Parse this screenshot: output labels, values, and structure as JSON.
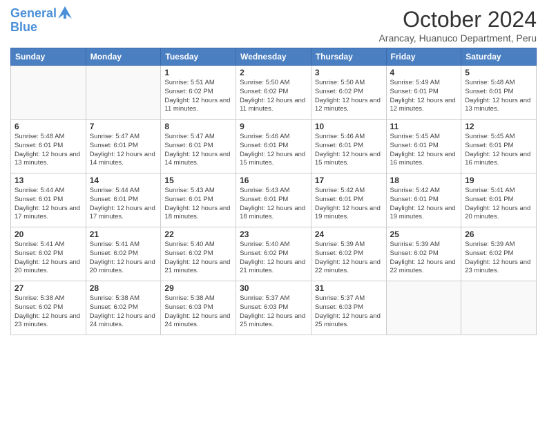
{
  "logo": {
    "line1": "General",
    "line2": "Blue"
  },
  "title": "October 2024",
  "subtitle": "Arancay, Huanuco Department, Peru",
  "days_of_week": [
    "Sunday",
    "Monday",
    "Tuesday",
    "Wednesday",
    "Thursday",
    "Friday",
    "Saturday"
  ],
  "weeks": [
    [
      {
        "day": "",
        "info": ""
      },
      {
        "day": "",
        "info": ""
      },
      {
        "day": "1",
        "info": "Sunrise: 5:51 AM\nSunset: 6:02 PM\nDaylight: 12 hours and 11 minutes."
      },
      {
        "day": "2",
        "info": "Sunrise: 5:50 AM\nSunset: 6:02 PM\nDaylight: 12 hours and 11 minutes."
      },
      {
        "day": "3",
        "info": "Sunrise: 5:50 AM\nSunset: 6:02 PM\nDaylight: 12 hours and 12 minutes."
      },
      {
        "day": "4",
        "info": "Sunrise: 5:49 AM\nSunset: 6:01 PM\nDaylight: 12 hours and 12 minutes."
      },
      {
        "day": "5",
        "info": "Sunrise: 5:48 AM\nSunset: 6:01 PM\nDaylight: 12 hours and 13 minutes."
      }
    ],
    [
      {
        "day": "6",
        "info": "Sunrise: 5:48 AM\nSunset: 6:01 PM\nDaylight: 12 hours and 13 minutes."
      },
      {
        "day": "7",
        "info": "Sunrise: 5:47 AM\nSunset: 6:01 PM\nDaylight: 12 hours and 14 minutes."
      },
      {
        "day": "8",
        "info": "Sunrise: 5:47 AM\nSunset: 6:01 PM\nDaylight: 12 hours and 14 minutes."
      },
      {
        "day": "9",
        "info": "Sunrise: 5:46 AM\nSunset: 6:01 PM\nDaylight: 12 hours and 15 minutes."
      },
      {
        "day": "10",
        "info": "Sunrise: 5:46 AM\nSunset: 6:01 PM\nDaylight: 12 hours and 15 minutes."
      },
      {
        "day": "11",
        "info": "Sunrise: 5:45 AM\nSunset: 6:01 PM\nDaylight: 12 hours and 16 minutes."
      },
      {
        "day": "12",
        "info": "Sunrise: 5:45 AM\nSunset: 6:01 PM\nDaylight: 12 hours and 16 minutes."
      }
    ],
    [
      {
        "day": "13",
        "info": "Sunrise: 5:44 AM\nSunset: 6:01 PM\nDaylight: 12 hours and 17 minutes."
      },
      {
        "day": "14",
        "info": "Sunrise: 5:44 AM\nSunset: 6:01 PM\nDaylight: 12 hours and 17 minutes."
      },
      {
        "day": "15",
        "info": "Sunrise: 5:43 AM\nSunset: 6:01 PM\nDaylight: 12 hours and 18 minutes."
      },
      {
        "day": "16",
        "info": "Sunrise: 5:43 AM\nSunset: 6:01 PM\nDaylight: 12 hours and 18 minutes."
      },
      {
        "day": "17",
        "info": "Sunrise: 5:42 AM\nSunset: 6:01 PM\nDaylight: 12 hours and 19 minutes."
      },
      {
        "day": "18",
        "info": "Sunrise: 5:42 AM\nSunset: 6:01 PM\nDaylight: 12 hours and 19 minutes."
      },
      {
        "day": "19",
        "info": "Sunrise: 5:41 AM\nSunset: 6:01 PM\nDaylight: 12 hours and 20 minutes."
      }
    ],
    [
      {
        "day": "20",
        "info": "Sunrise: 5:41 AM\nSunset: 6:02 PM\nDaylight: 12 hours and 20 minutes."
      },
      {
        "day": "21",
        "info": "Sunrise: 5:41 AM\nSunset: 6:02 PM\nDaylight: 12 hours and 20 minutes."
      },
      {
        "day": "22",
        "info": "Sunrise: 5:40 AM\nSunset: 6:02 PM\nDaylight: 12 hours and 21 minutes."
      },
      {
        "day": "23",
        "info": "Sunrise: 5:40 AM\nSunset: 6:02 PM\nDaylight: 12 hours and 21 minutes."
      },
      {
        "day": "24",
        "info": "Sunrise: 5:39 AM\nSunset: 6:02 PM\nDaylight: 12 hours and 22 minutes."
      },
      {
        "day": "25",
        "info": "Sunrise: 5:39 AM\nSunset: 6:02 PM\nDaylight: 12 hours and 22 minutes."
      },
      {
        "day": "26",
        "info": "Sunrise: 5:39 AM\nSunset: 6:02 PM\nDaylight: 12 hours and 23 minutes."
      }
    ],
    [
      {
        "day": "27",
        "info": "Sunrise: 5:38 AM\nSunset: 6:02 PM\nDaylight: 12 hours and 23 minutes."
      },
      {
        "day": "28",
        "info": "Sunrise: 5:38 AM\nSunset: 6:02 PM\nDaylight: 12 hours and 24 minutes."
      },
      {
        "day": "29",
        "info": "Sunrise: 5:38 AM\nSunset: 6:03 PM\nDaylight: 12 hours and 24 minutes."
      },
      {
        "day": "30",
        "info": "Sunrise: 5:37 AM\nSunset: 6:03 PM\nDaylight: 12 hours and 25 minutes."
      },
      {
        "day": "31",
        "info": "Sunrise: 5:37 AM\nSunset: 6:03 PM\nDaylight: 12 hours and 25 minutes."
      },
      {
        "day": "",
        "info": ""
      },
      {
        "day": "",
        "info": ""
      }
    ]
  ]
}
